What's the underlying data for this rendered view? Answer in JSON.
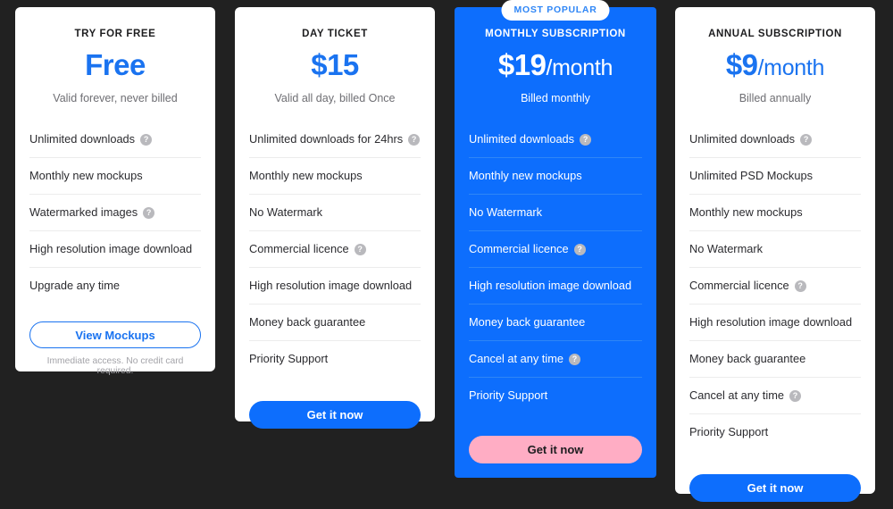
{
  "theme": {
    "background": "#212121",
    "accent_blue": "#0d6efd",
    "price_blue": "#1a73f0",
    "pink": "#ffadc4",
    "card_white": "#ffffff",
    "divider_light": "#ececec",
    "divider_blue": "#2f86f6",
    "help_icon_grey": "#b9b9bd"
  },
  "help_icon_glyph": "?",
  "plans": [
    {
      "name": "TRY FOR FREE",
      "price": "Free",
      "period": "",
      "billing": "Valid forever, never billed",
      "badge": null,
      "featured": false,
      "features": [
        {
          "label": "Unlimited downloads",
          "help": true
        },
        {
          "label": "Monthly new mockups",
          "help": false
        },
        {
          "label": "Watermarked images",
          "help": true
        },
        {
          "label": "High resolution image download",
          "help": false
        },
        {
          "label": "Upgrade any time",
          "help": false
        }
      ],
      "cta": {
        "label": "View Mockups",
        "style": "outline-blue"
      },
      "fineprint": "Immediate access. No credit card required."
    },
    {
      "name": "DAY TICKET",
      "price": "$15",
      "period": "",
      "billing": "Valid all day, billed Once",
      "badge": null,
      "featured": false,
      "features": [
        {
          "label": "Unlimited downloads for 24hrs",
          "help": true
        },
        {
          "label": "Monthly new mockups",
          "help": false
        },
        {
          "label": "No Watermark",
          "help": false
        },
        {
          "label": "Commercial licence",
          "help": true
        },
        {
          "label": "High resolution image download",
          "help": false
        },
        {
          "label": "Money back guarantee",
          "help": false
        },
        {
          "label": "Priority Support",
          "help": false
        }
      ],
      "cta": {
        "label": "Get it now",
        "style": "solid-blue"
      },
      "fineprint": null
    },
    {
      "name": "MONTHLY SUBSCRIPTION",
      "price": "$19",
      "period": "/month",
      "billing": "Billed monthly",
      "badge": "MOST POPULAR",
      "featured": true,
      "features": [
        {
          "label": "Unlimited downloads",
          "help": true
        },
        {
          "label": "Monthly new mockups",
          "help": false
        },
        {
          "label": "No Watermark",
          "help": false
        },
        {
          "label": "Commercial licence",
          "help": true
        },
        {
          "label": "High resolution image download",
          "help": false
        },
        {
          "label": "Money back guarantee",
          "help": false
        },
        {
          "label": "Cancel at any time",
          "help": true
        },
        {
          "label": "Priority Support",
          "help": false
        }
      ],
      "cta": {
        "label": "Get it now",
        "style": "solid-pink"
      },
      "fineprint": null
    },
    {
      "name": "ANNUAL SUBSCRIPTION",
      "price": "$9",
      "period": "/month",
      "billing": "Billed annually",
      "badge": null,
      "featured": false,
      "features": [
        {
          "label": "Unlimited downloads",
          "help": true
        },
        {
          "label": "Unlimited PSD Mockups",
          "help": false
        },
        {
          "label": "Monthly new mockups",
          "help": false
        },
        {
          "label": "No Watermark",
          "help": false
        },
        {
          "label": "Commercial licence",
          "help": true
        },
        {
          "label": "High resolution image download",
          "help": false
        },
        {
          "label": "Money back guarantee",
          "help": false
        },
        {
          "label": "Cancel at any time",
          "help": true
        },
        {
          "label": "Priority Support",
          "help": false
        }
      ],
      "cta": {
        "label": "Get it now",
        "style": "solid-blue"
      },
      "fineprint": null
    }
  ]
}
